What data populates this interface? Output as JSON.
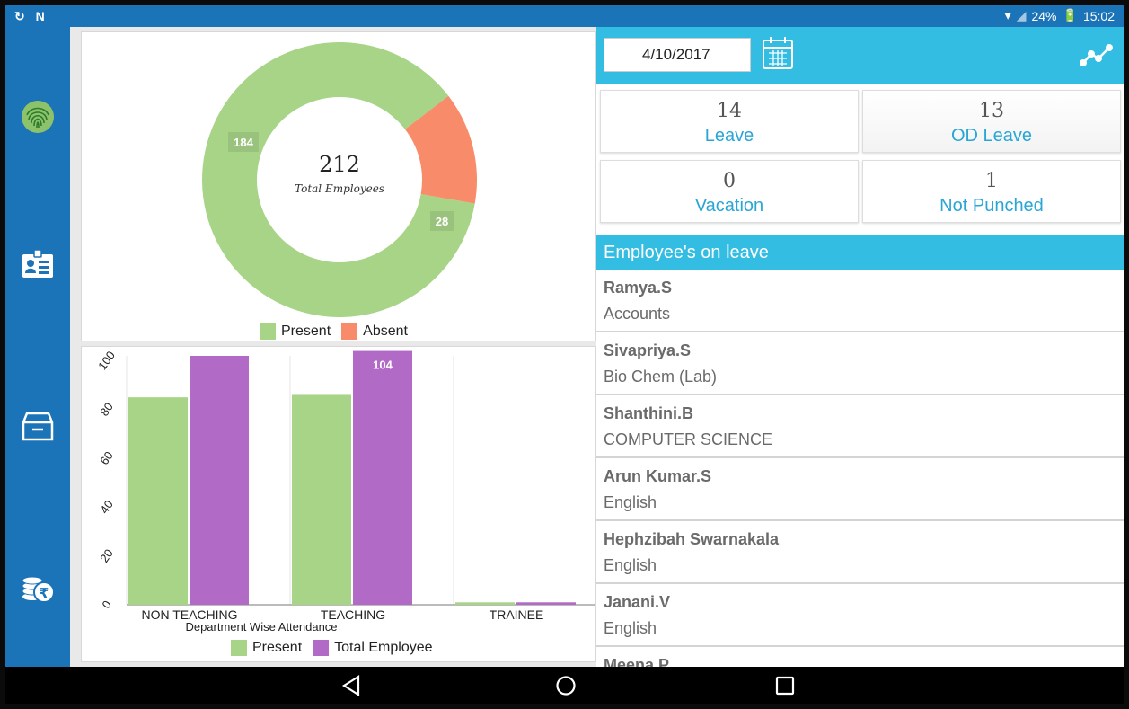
{
  "status": {
    "left_icons": "sync-icon nfc-icon",
    "battery": "24%",
    "time": "15:02"
  },
  "colors": {
    "sidebar": "#1b73b8",
    "accent": "#33bde2",
    "present": "#a7d487",
    "absent": "#f88b6a",
    "total": "#b16ac5"
  },
  "sidebar": {
    "items": [
      "fingerprint-icon",
      "id-card-icon",
      "archive-box-icon",
      "rupee-coins-icon"
    ]
  },
  "date": {
    "value": "4/10/2017"
  },
  "stats": [
    {
      "value": "14",
      "label": "Leave"
    },
    {
      "value": "13",
      "label": "OD Leave"
    },
    {
      "value": "0",
      "label": "Vacation"
    },
    {
      "value": "1",
      "label": "Not Punched"
    }
  ],
  "leave": {
    "header": "Employee's on leave",
    "items": [
      {
        "name": "Ramya.S",
        "dept": "Accounts"
      },
      {
        "name": "Sivapriya.S",
        "dept": "Bio Chem  (Lab)"
      },
      {
        "name": "Shanthini.B",
        "dept": "COMPUTER SCIENCE"
      },
      {
        "name": "Arun Kumar.S",
        "dept": "English"
      },
      {
        "name": "Hephzibah Swarnakala",
        "dept": "English"
      },
      {
        "name": "Janani.V",
        "dept": "English"
      },
      {
        "name": "Meena.P",
        "dept": ""
      }
    ]
  },
  "chart_data": [
    {
      "type": "pie",
      "donut": true,
      "center_value": "212",
      "center_label": "Total Employees",
      "slices": [
        {
          "name": "Present",
          "value": 184,
          "color": "#a7d487"
        },
        {
          "name": "Absent",
          "value": 28,
          "color": "#f88b6a"
        }
      ],
      "legend": [
        "Present",
        "Absent"
      ],
      "legend_position": "bottom"
    },
    {
      "type": "bar",
      "categories": [
        "NON TEACHING",
        "TEACHING",
        "TRAINEE"
      ],
      "series": [
        {
          "name": "Present",
          "values": [
            85,
            86,
            1
          ],
          "color": "#a7d487"
        },
        {
          "name": "Total Employee",
          "values": [
            102,
            104,
            1
          ],
          "color": "#b16ac5"
        }
      ],
      "data_labels": [
        {
          "series": 1,
          "index": 1,
          "text": "104"
        }
      ],
      "xlabel": "Department Wise Attendance",
      "ylabel": "",
      "yticks": [
        "0",
        "20",
        "40",
        "60",
        "80",
        "100"
      ],
      "ylim": [
        0,
        102
      ],
      "legend_position": "bottom"
    }
  ]
}
